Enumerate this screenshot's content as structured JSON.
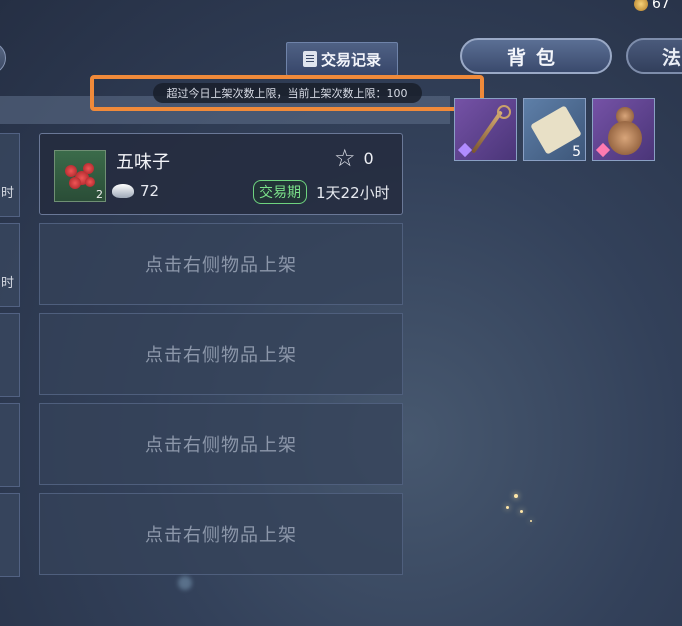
{
  "header": {
    "trade_record": "交易记录",
    "tab_bag": "背包",
    "tab_spell": "法",
    "currency_value": "67"
  },
  "notice": {
    "text": "超过今日上架次数上限，当前上架次数上限：100"
  },
  "left_column": {
    "labels": [
      "时",
      "时"
    ]
  },
  "listing": {
    "item_name": "五味子",
    "thumb_count": "2",
    "star_count": "0",
    "price": "72",
    "badge": "交易期",
    "time_left": "1天22小时"
  },
  "empty_slots": [
    "点击右侧物品上架",
    "点击右侧物品上架",
    "点击右侧物品上架",
    "点击右侧物品上架"
  ],
  "inventory": [
    {
      "icon": "staff-icon",
      "count": ""
    },
    {
      "icon": "talisman-icon",
      "count": "5"
    },
    {
      "icon": "gourd-icon",
      "count": ""
    }
  ]
}
